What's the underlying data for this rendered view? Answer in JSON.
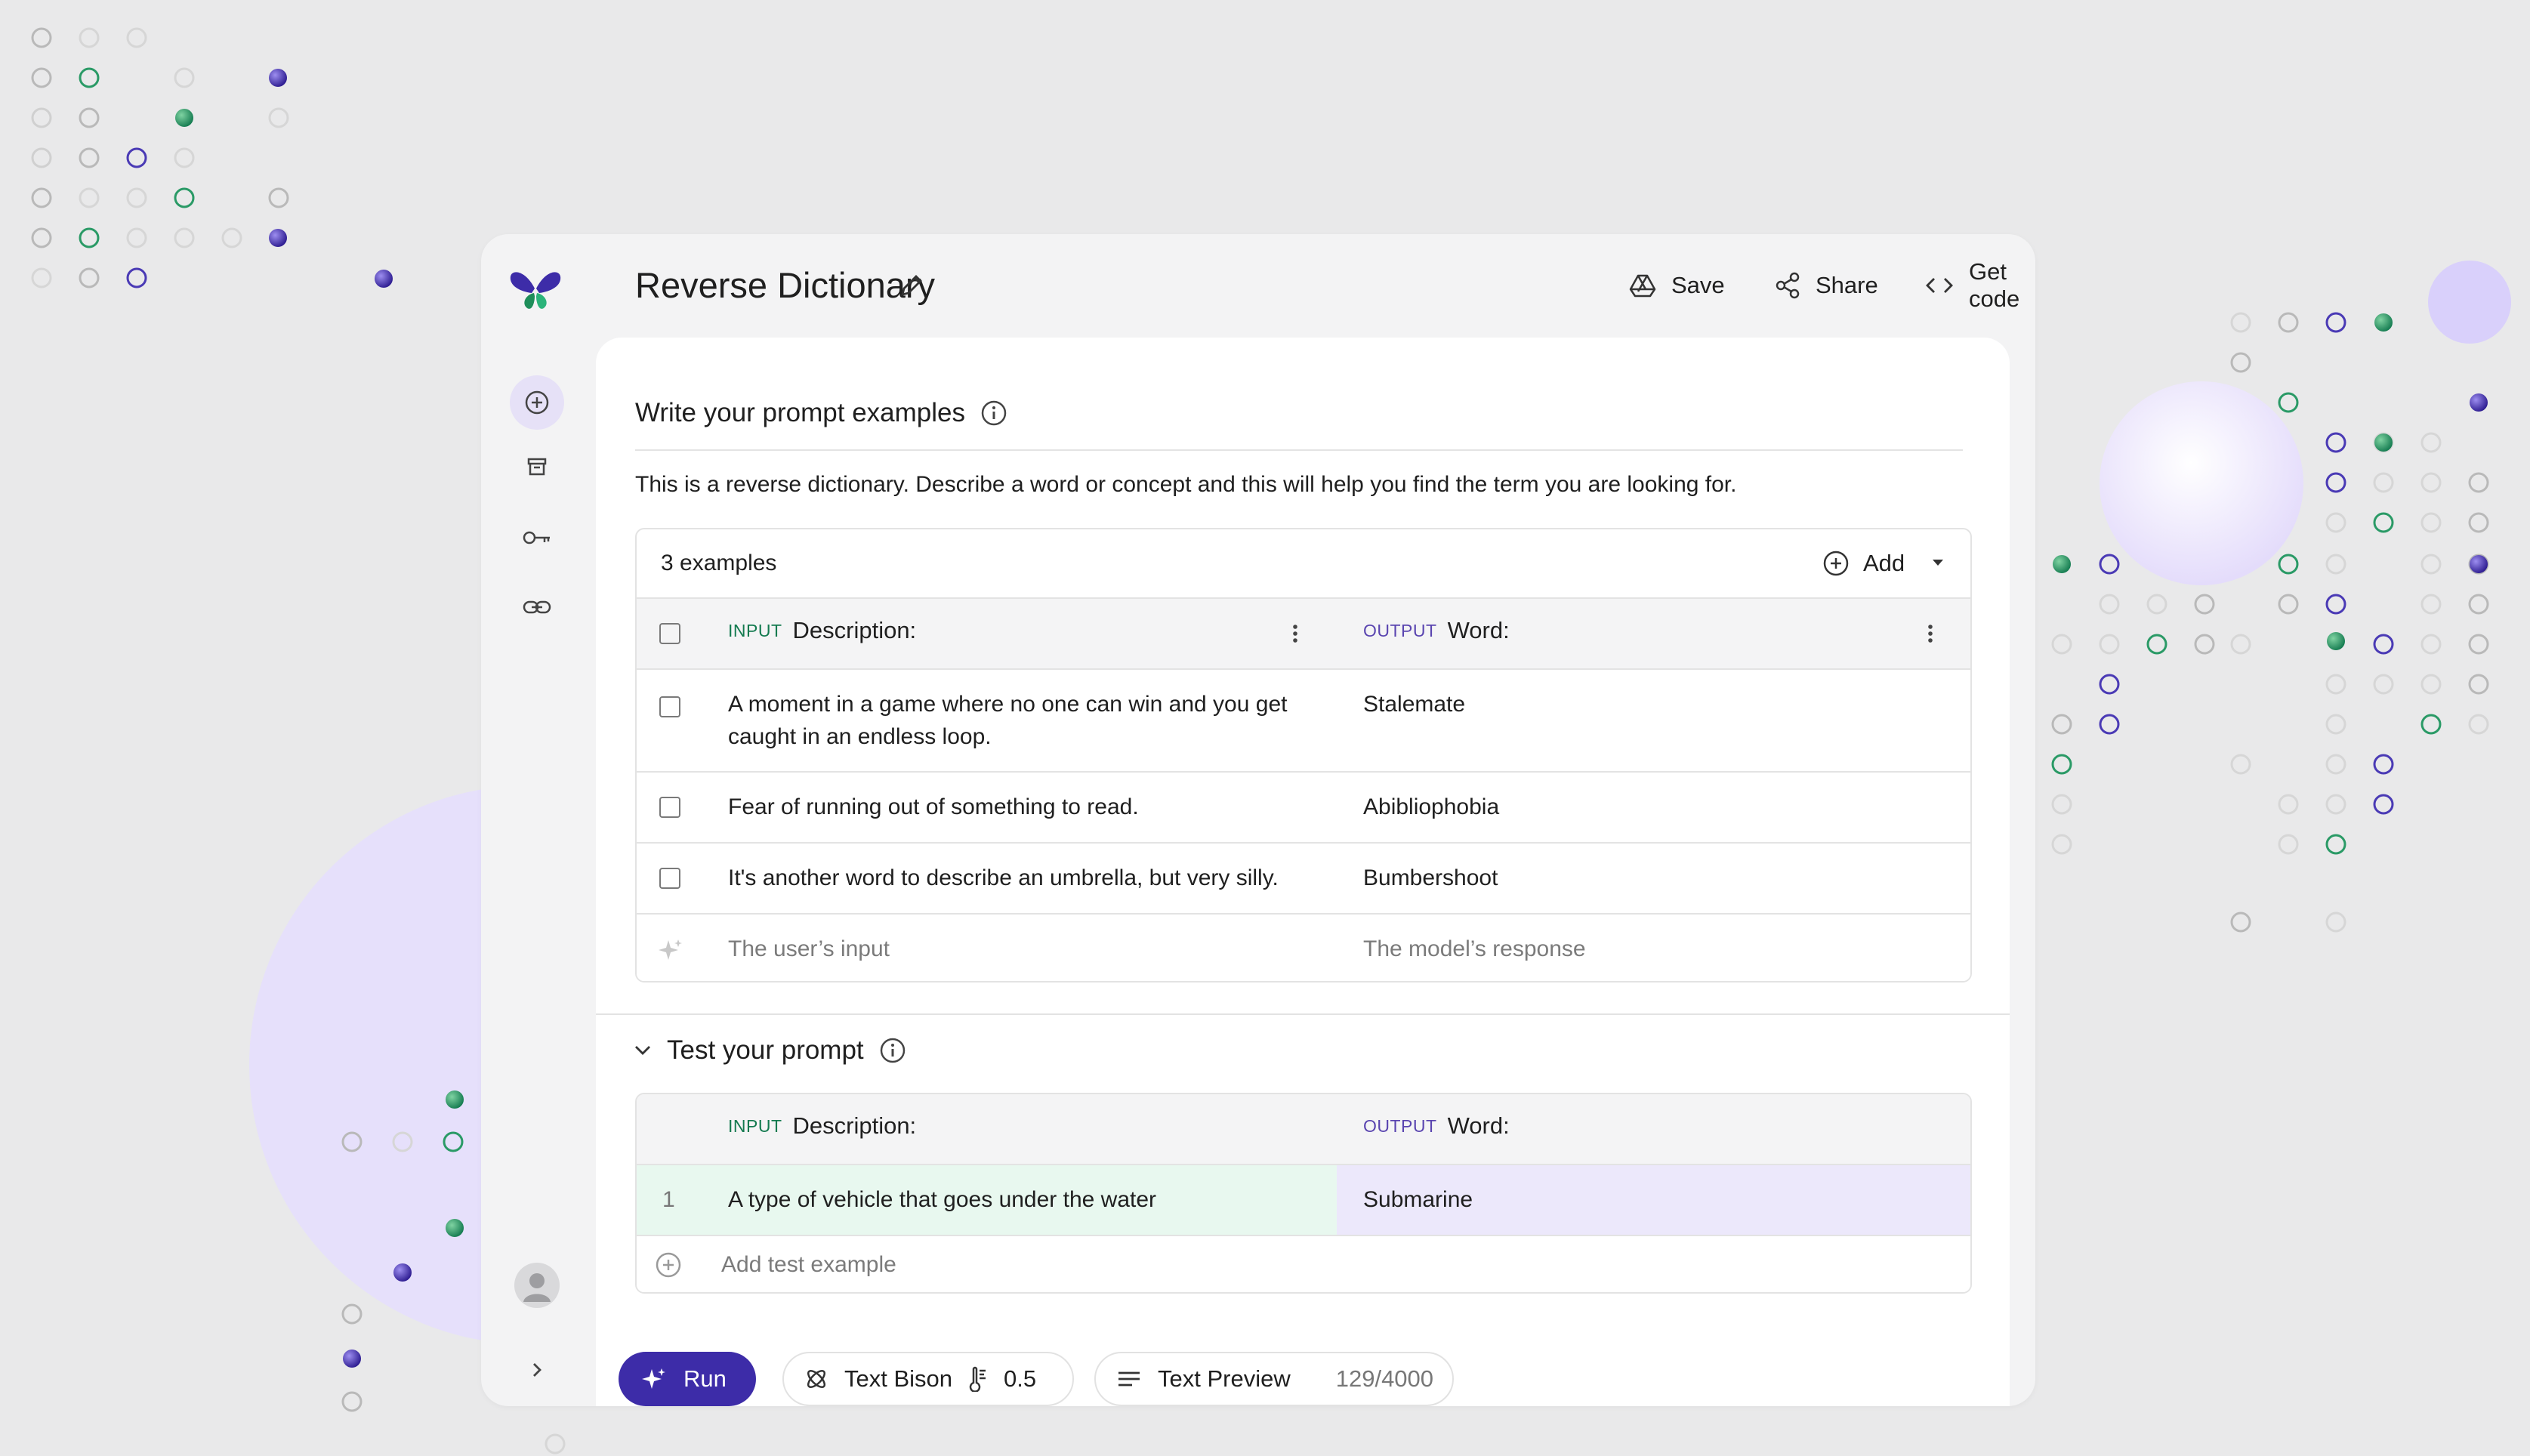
{
  "app": {
    "title": "Reverse Dictionary",
    "accent": "#3d2ca8",
    "green": "#1e8e5a",
    "lavender": "#e9e4fb"
  },
  "toolbar": {
    "save_label": "Save",
    "share_label": "Share",
    "get_code_label": "Get code"
  },
  "sidebar": {
    "items": [
      {
        "icon": "add-circle-icon",
        "active": true
      },
      {
        "icon": "archive-icon",
        "active": false
      },
      {
        "icon": "key-icon",
        "active": false
      },
      {
        "icon": "link-icon",
        "active": false
      }
    ]
  },
  "examples_section": {
    "title": "Write your prompt examples",
    "description": "This is a reverse dictionary. Describe a word or concept and this will help you find the term you are looking for.",
    "count_label": "3 examples",
    "add_label": "Add",
    "input_tag": "INPUT",
    "input_header": "Description:",
    "output_tag": "OUTPUT",
    "output_header": "Word:",
    "rows": [
      {
        "input": "A moment in a game where no one can win and you get caught in an endless loop.",
        "output": "Stalemate"
      },
      {
        "input": "Fear of running out of something to read.",
        "output": "Abibliophobia"
      },
      {
        "input": "It's another word to describe an umbrella, but very silly.",
        "output": "Bumbershoot"
      }
    ],
    "placeholder_input": "The user’s input",
    "placeholder_output": "The model’s response"
  },
  "test_section": {
    "title": "Test your prompt",
    "input_tag": "INPUT",
    "input_header": "Description:",
    "output_tag": "OUTPUT",
    "output_header": "Word:",
    "rows": [
      {
        "index": "1",
        "input": "A type of vehicle that goes under the water",
        "output": "Submarine"
      }
    ],
    "add_label": "Add test example"
  },
  "bottom_bar": {
    "run_label": "Run",
    "model_label": "Text Bison",
    "temperature": "0.5",
    "preview_label": "Text Preview",
    "token_count": "129/4000"
  }
}
